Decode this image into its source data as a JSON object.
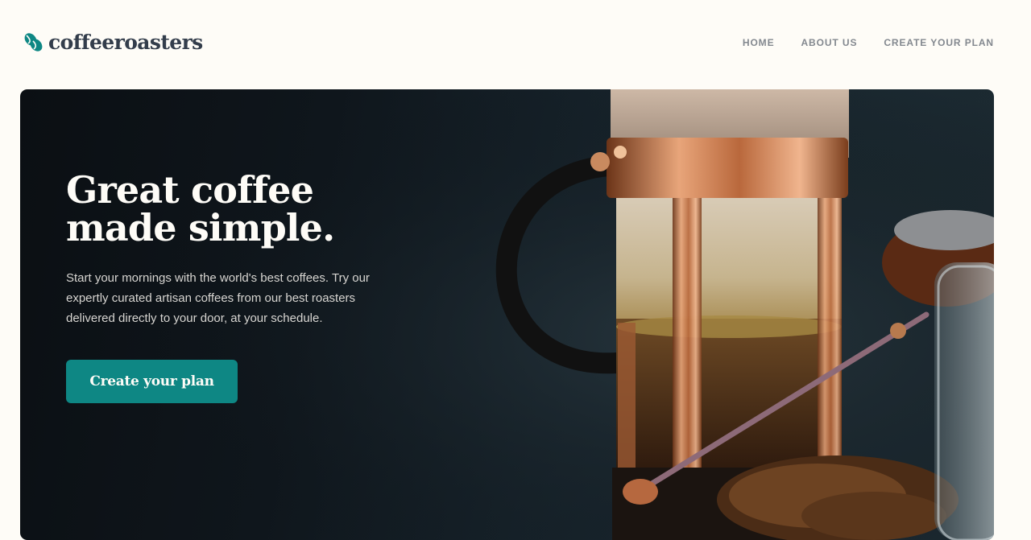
{
  "brand": {
    "name": "coffeeroasters",
    "icon": "coffee-bean-icon"
  },
  "nav": {
    "items": [
      {
        "label": "HOME"
      },
      {
        "label": "ABOUT US"
      },
      {
        "label": "CREATE YOUR PLAN"
      }
    ]
  },
  "hero": {
    "title_line1": "Great coffee",
    "title_line2": "made simple.",
    "description": "Start your mornings with the world's best coffees. Try our expertly curated artisan coffees from our best roasters delivered directly to your door, at your schedule.",
    "cta_label": "Create your plan"
  },
  "colors": {
    "brand_teal": "#0E8784",
    "dark_text": "#333D4B",
    "nav_grey": "#83888F",
    "background": "#FEFCF7",
    "copper": "#C37B4A"
  }
}
